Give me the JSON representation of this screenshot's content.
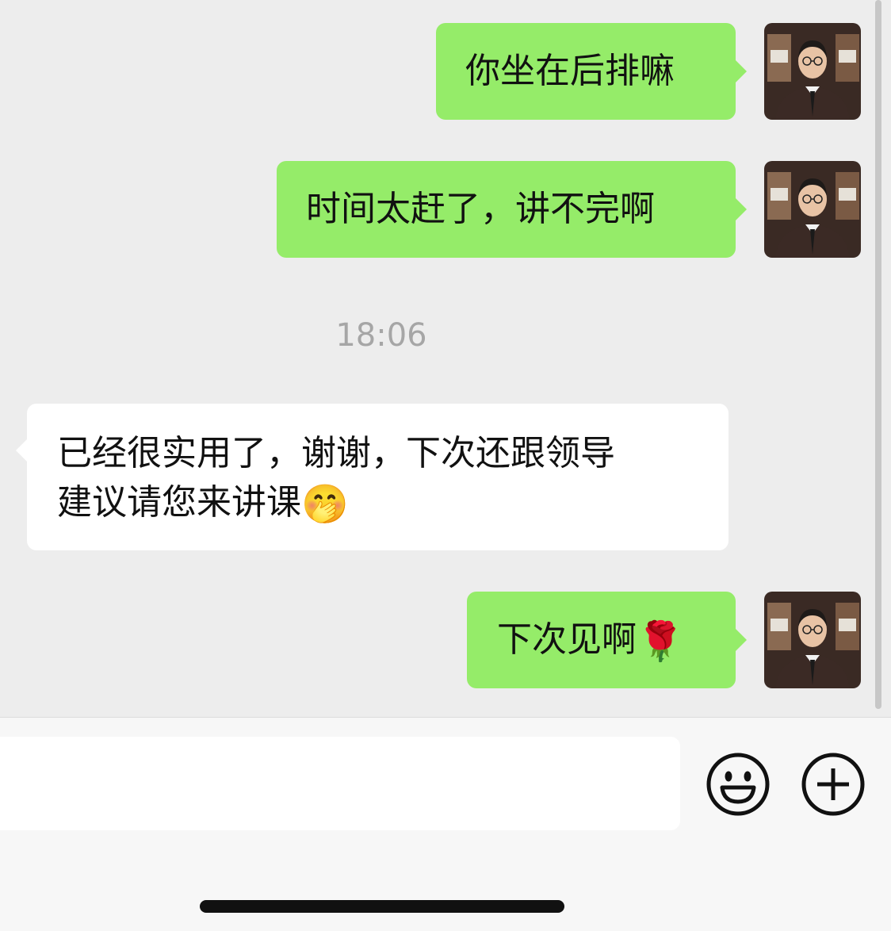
{
  "chat": {
    "messages": [
      {
        "side": "out",
        "text": "你坐在后排嘛"
      },
      {
        "side": "out",
        "text": "时间太赶了，讲不完啊"
      },
      {
        "side": "in",
        "line1": "已经很实用了，谢谢，下次还跟领导",
        "line2": "建议请您来讲课",
        "emoji": "🤭"
      },
      {
        "side": "out",
        "text": "下次见啊",
        "emoji": "🌹"
      }
    ],
    "timestamp": "18:06"
  },
  "input": {
    "value": "",
    "emoji_icon": "smiley-face-icon",
    "more_icon": "plus-circle-icon"
  },
  "colors": {
    "outgoing_bubble": "#95ec69",
    "incoming_bubble": "#ffffff",
    "background": "#ededed"
  }
}
